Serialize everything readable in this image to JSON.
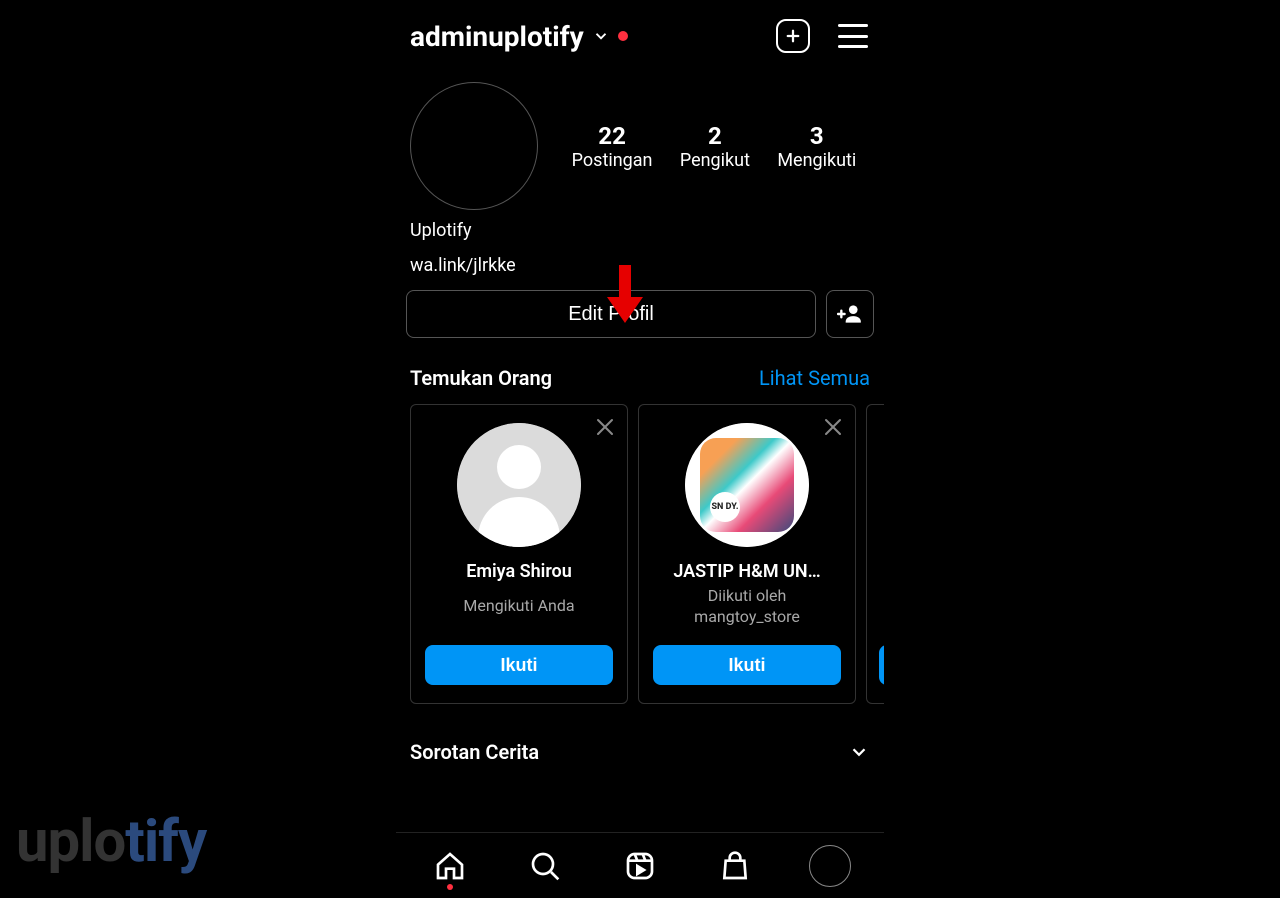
{
  "header": {
    "username": "adminuplotify"
  },
  "stats": {
    "posts": {
      "value": "22",
      "label": "Postingan"
    },
    "followers": {
      "value": "2",
      "label": "Pengikut"
    },
    "following": {
      "value": "3",
      "label": "Mengikuti"
    }
  },
  "bio": {
    "name": "Uplotify",
    "link": "wa.link/jlrkke"
  },
  "actions": {
    "edit_profile": "Edit Profil"
  },
  "discover": {
    "title": "Temukan Orang",
    "see_all": "Lihat Semua",
    "cards": [
      {
        "name": "Emiya Shirou",
        "sub": "Mengikuti Anda",
        "follow": "Ikuti",
        "avatar_type": "placeholder"
      },
      {
        "name": "JASTIP H&M UN…",
        "sub": "Diikuti oleh mangtoy_store",
        "follow": "Ikuti",
        "avatar_type": "color",
        "badge": "SN DY."
      }
    ]
  },
  "highlights": {
    "title": "Sorotan Cerita"
  },
  "watermark": {
    "pre": "uplo",
    "accent": "tify"
  }
}
